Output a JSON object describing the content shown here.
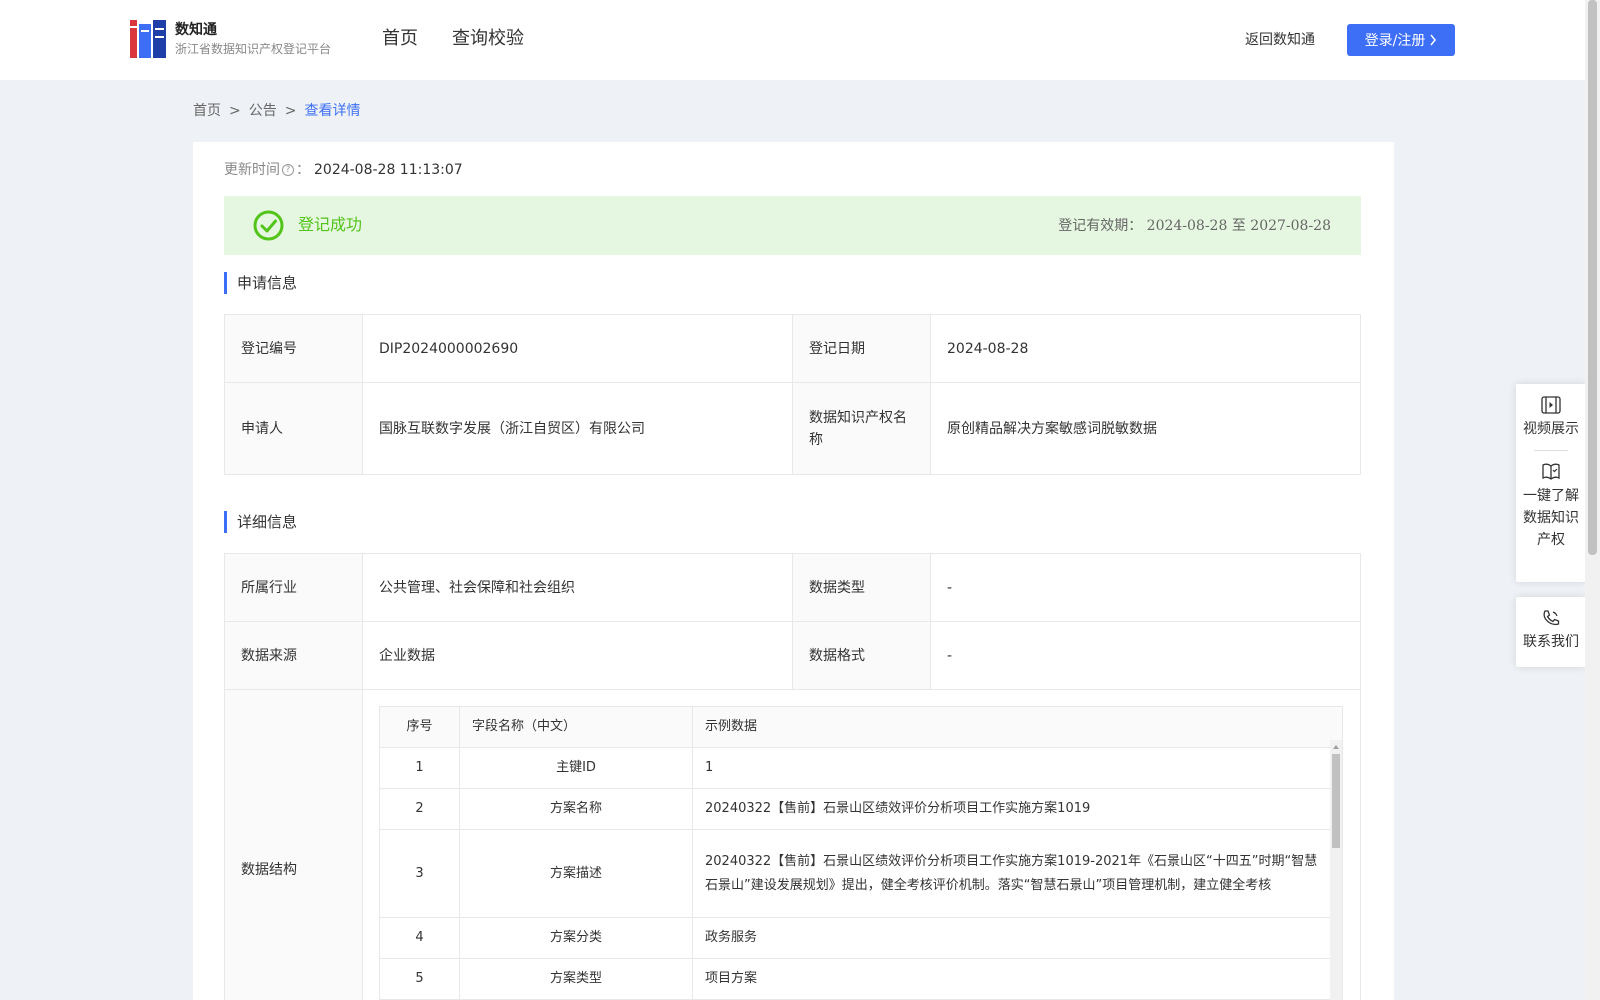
{
  "header": {
    "logo_name": "数知通",
    "logo_subtitle": "浙江省数据知识产权登记平台",
    "nav": [
      "首页",
      "查询校验"
    ],
    "back_link": "返回数知通",
    "login_button": "登录/注册"
  },
  "breadcrumb": {
    "home": "首页",
    "sep": ">",
    "notice": "公告",
    "current": "查看详情"
  },
  "update": {
    "label": "更新时间",
    "colon": "：",
    "value": "2024-08-28 11:13:07"
  },
  "status": {
    "text": "登记成功",
    "validity_label": "登记有效期：",
    "validity_start": "2024-08-28",
    "validity_to": "至",
    "validity_end": "2027-08-28",
    "colors": {
      "success": "#52c41a",
      "bg": "#e6f7e1",
      "accent": "#3d6ff6"
    }
  },
  "application": {
    "title": "申请信息",
    "reg_no_label": "登记编号",
    "reg_no": "DIP2024000002690",
    "reg_date_label": "登记日期",
    "reg_date": "2024-08-28",
    "applicant_label": "申请人",
    "applicant": "国脉互联数字发展（浙江自贸区）有限公司",
    "ip_name_label": "数据知识产权名称",
    "ip_name": "原创精品解决方案敏感词脱敏数据"
  },
  "detail": {
    "title": "详细信息",
    "industry_label": "所属行业",
    "industry": "公共管理、社会保障和社会组织",
    "data_type_label": "数据类型",
    "data_type": "-",
    "source_label": "数据来源",
    "source": "企业数据",
    "format_label": "数据格式",
    "format": "-",
    "structure_label": "数据结构",
    "structure": {
      "headers": [
        "序号",
        "字段名称（中文）",
        "示例数据"
      ],
      "rows": [
        [
          "1",
          "主键ID",
          "1"
        ],
        [
          "2",
          "方案名称",
          "20240322【售前】石景山区绩效评价分析项目工作实施方案1019"
        ],
        [
          "3",
          "方案描述",
          "20240322【售前】石景山区绩效评价分析项目工作实施方案1019-2021年《石景山区“十四五”时期“智慧石景山”建设发展规划》提出，健全考核评价机制。落实“智慧石景山”项目管理机制，建立健全考核"
        ],
        [
          "4",
          "方案分类",
          "政务服务"
        ],
        [
          "5",
          "方案类型",
          "项目方案"
        ]
      ]
    }
  },
  "float_panel": {
    "video": "视频展示",
    "learn": "一键了解数据知识产权",
    "contact": "联系我们"
  }
}
